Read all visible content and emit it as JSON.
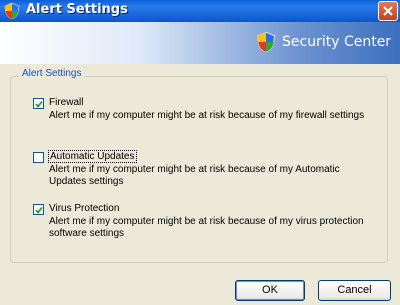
{
  "window": {
    "title": "Alert Settings"
  },
  "banner": {
    "title": "Security Center"
  },
  "group": {
    "label": "Alert Settings"
  },
  "options": [
    {
      "label": "Firewall",
      "checked": true,
      "description": "Alert me if my computer might be at risk because of my firewall settings"
    },
    {
      "label": "Automatic Updates",
      "checked": false,
      "description": "Alert me if my computer might be at risk because of my Automatic Updates settings"
    },
    {
      "label": "Virus Protection",
      "checked": true,
      "description": "Alert me if my computer might be at risk because of my virus protection software settings"
    }
  ],
  "buttons": {
    "ok": "OK",
    "cancel": "Cancel"
  },
  "icons": {
    "window": "security-shield-icon",
    "close": "close-icon",
    "banner": "security-shield-icon",
    "check": "checkmark-icon"
  },
  "colors": {
    "titlebar": "#0b55d0",
    "group_label": "#1550c8",
    "close": "#c0421d",
    "check": "#21a121"
  }
}
